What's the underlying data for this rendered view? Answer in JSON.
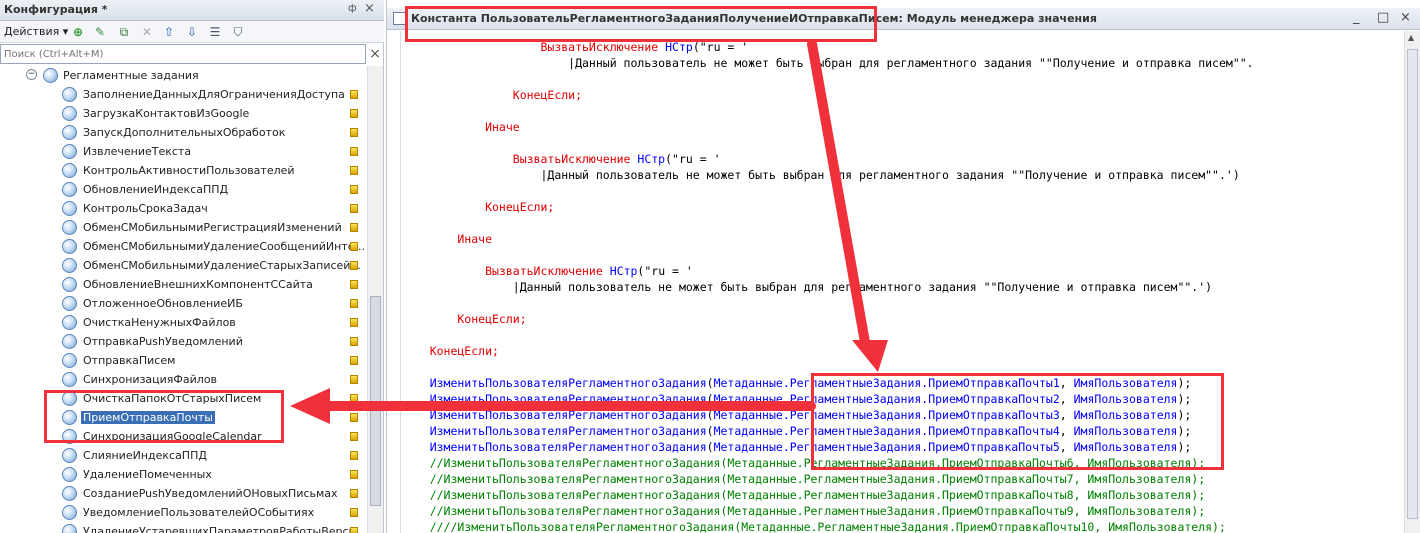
{
  "left_panel": {
    "title": "Конфигурация *",
    "pin": "ф",
    "close": "×",
    "actions_label": "Действия ▾",
    "toolbar_icons": [
      "add-icon",
      "edit-icon",
      "copy-icon",
      "delete-icon",
      "move-up-icon",
      "move-down-icon",
      "list-icon",
      "filter-icon"
    ],
    "search_placeholder": "Поиск (Ctrl+Alt+M)",
    "search_clear": "×",
    "group": {
      "toggle": "−",
      "label": "Регламентные задания"
    },
    "items": [
      "ЗаполнениеДанныхДляОграниченияДоступа",
      "ЗагрузкаКонтактовИзGoogle",
      "ЗапускДополнительныхОбработок",
      "ИзвлечениеТекста",
      "КонтрольАктивностиПользователей",
      "ОбновлениеИндексаППД",
      "КонтрольСрокаЗадач",
      "ОбменСМобильнымиРегистрацияИзменений",
      "ОбменСМобильнымиУдалениеСообщенийИнте...",
      "ОбменСМобильнымиУдалениеСтарыхЗаписей...",
      "ОбновлениеВнешнихКомпонентССайта",
      "ОтложенноеОбновлениеИБ",
      "ОчисткаНенужныхФайлов",
      "ОтправкаPushУведомлений",
      "ОтправкаПисем",
      "СинхронизацияФайлов",
      "ОчисткаПапокОтСтарыхПисем",
      "ПриемОтправкаПочты",
      "СинхронизацияGoogleCalendar",
      "СлияниеИндексаППД",
      "УдалениеПомеченных",
      "СозданиеPushУведомленийОНовыхПисьмах",
      "УведомлениеПользователейОСобытиях",
      "УдалениеУстаревшихПараметровРаботыВерси..."
    ],
    "selected_index": 17
  },
  "editor": {
    "title": "Константа ПользовательРегламентногоЗаданияПолучениеИОтправкаПисем: Модуль менеджера значения",
    "window_controls": [
      "_",
      "□",
      "×"
    ],
    "lines": [
      [
        [
          "kw",
          "                    ВызватьИсключение "
        ],
        [
          "fn",
          "НСтр"
        ],
        [
          "tx",
          "(\"ru = '"
        ]
      ],
      [
        [
          "tx",
          "                        |Данный пользователь не может быть выбран для регламентного задания \"\"Получение и отправка писем\"\"."
        ]
      ],
      [
        [
          "tx",
          ""
        ]
      ],
      [
        [
          "kw",
          "                КонецЕсли;"
        ]
      ],
      [
        [
          "tx",
          ""
        ]
      ],
      [
        [
          "kw",
          "            Иначе"
        ]
      ],
      [
        [
          "tx",
          ""
        ]
      ],
      [
        [
          "kw",
          "                ВызватьИсключение "
        ],
        [
          "fn",
          "НСтр"
        ],
        [
          "tx",
          "(\"ru = '"
        ]
      ],
      [
        [
          "tx",
          "                    |Данный пользователь не может быть выбран для регламентного задания \"\"Получение и отправка писем\"\".')"
        ]
      ],
      [
        [
          "tx",
          ""
        ]
      ],
      [
        [
          "kw",
          "            КонецЕсли;"
        ]
      ],
      [
        [
          "tx",
          ""
        ]
      ],
      [
        [
          "kw",
          "        Иначе"
        ]
      ],
      [
        [
          "tx",
          ""
        ]
      ],
      [
        [
          "kw",
          "            ВызватьИсключение "
        ],
        [
          "fn",
          "НСтр"
        ],
        [
          "tx",
          "(\"ru = '"
        ]
      ],
      [
        [
          "tx",
          "                |Данный пользователь не может быть выбран для регламентного задания \"\"Получение и отправка писем\"\".')"
        ]
      ],
      [
        [
          "tx",
          ""
        ]
      ],
      [
        [
          "kw",
          "        КонецЕсли;"
        ]
      ],
      [
        [
          "tx",
          ""
        ]
      ],
      [
        [
          "kw",
          "    КонецЕсли;"
        ]
      ],
      [
        [
          "tx",
          ""
        ]
      ],
      [
        [
          "fn",
          "    ИзменитьПользователяРегламентногоЗадания"
        ],
        [
          "tx",
          "("
        ],
        [
          "fn",
          "Метаданные.РегламентныеЗадания.ПриемОтправкаПочты1"
        ],
        [
          "tx",
          ", "
        ],
        [
          "fn",
          "ИмяПользователя"
        ],
        [
          "tx",
          ");"
        ]
      ],
      [
        [
          "fn",
          "    ИзменитьПользователяРегламентногоЗадания"
        ],
        [
          "tx",
          "("
        ],
        [
          "fn",
          "Метаданные.РегламентныеЗадания.ПриемОтправкаПочты2"
        ],
        [
          "tx",
          ", "
        ],
        [
          "fn",
          "ИмяПользователя"
        ],
        [
          "tx",
          ");"
        ]
      ],
      [
        [
          "fn",
          "    ИзменитьПользователяРегламентногоЗадания"
        ],
        [
          "tx",
          "("
        ],
        [
          "fn",
          "Метаданные.РегламентныеЗадания.ПриемОтправкаПочты3"
        ],
        [
          "tx",
          ", "
        ],
        [
          "fn",
          "ИмяПользователя"
        ],
        [
          "tx",
          ");"
        ]
      ],
      [
        [
          "fn",
          "    ИзменитьПользователяРегламентногоЗадания"
        ],
        [
          "tx",
          "("
        ],
        [
          "fn",
          "Метаданные.РегламентныеЗадания.ПриемОтправкаПочты4"
        ],
        [
          "tx",
          ", "
        ],
        [
          "fn",
          "ИмяПользователя"
        ],
        [
          "tx",
          ");"
        ]
      ],
      [
        [
          "fn",
          "    ИзменитьПользователяРегламентногоЗадания"
        ],
        [
          "tx",
          "("
        ],
        [
          "fn",
          "Метаданные.РегламентныеЗадания.ПриемОтправкаПочты5"
        ],
        [
          "tx",
          ", "
        ],
        [
          "fn",
          "ИмяПользователя"
        ],
        [
          "tx",
          ");"
        ]
      ],
      [
        [
          "cm",
          "    //ИзменитьПользователяРегламентногоЗадания(Метаданные.РегламентныеЗадания.ПриемОтправкаПочты6, ИмяПользователя);"
        ]
      ],
      [
        [
          "cm",
          "    //ИзменитьПользователяРегламентногоЗадания(Метаданные.РегламентныеЗадания.ПриемОтправкаПочты7, ИмяПользователя);"
        ]
      ],
      [
        [
          "cm",
          "    //ИзменитьПользователяРегламентногоЗадания(Метаданные.РегламентныеЗадания.ПриемОтправкаПочты8, ИмяПользователя);"
        ]
      ],
      [
        [
          "cm",
          "    //ИзменитьПользователяРегламентногоЗадания(Метаданные.РегламентныеЗадания.ПриемОтправкаПочты9, ИмяПользователя);"
        ]
      ],
      [
        [
          "cm",
          "    ////ИзменитьПользователяРегламентногоЗадания(Метаданные.РегламентныеЗадания.ПриемОтправкаПочты10, ИмяПользователя);"
        ]
      ]
    ]
  },
  "colors": {
    "annotation": "#f0303a",
    "keyword": "#e00000",
    "identifier": "#0000ff",
    "comment": "#008000",
    "selection": "#3a6fb5"
  }
}
